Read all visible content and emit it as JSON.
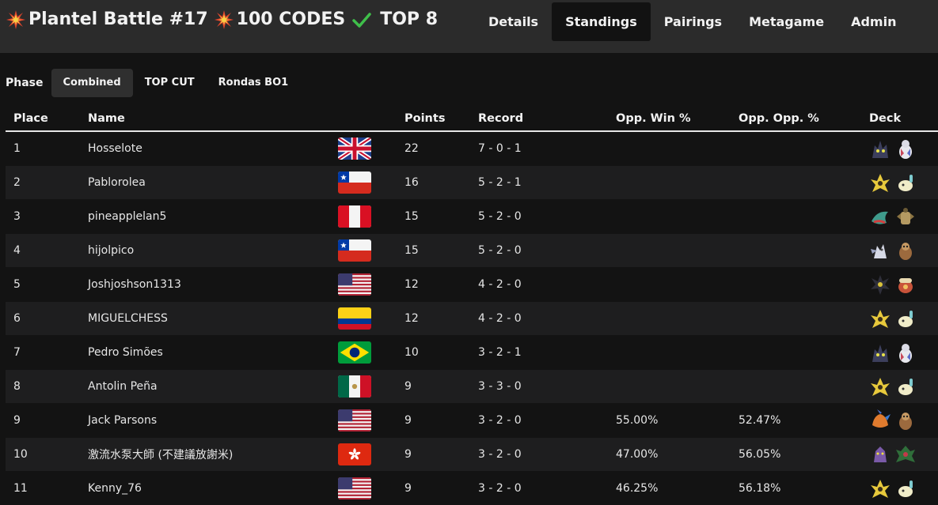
{
  "header": {
    "title_parts": [
      "Plantel Battle #17",
      "100 CODES",
      "TOP 8"
    ],
    "nav": [
      {
        "label": "Details",
        "active": false
      },
      {
        "label": "Standings",
        "active": true
      },
      {
        "label": "Pairings",
        "active": false
      },
      {
        "label": "Metagame",
        "active": false
      },
      {
        "label": "Admin",
        "active": false
      }
    ]
  },
  "phase": {
    "label": "Phase",
    "options": [
      {
        "label": "Combined",
        "active": true
      },
      {
        "label": "TOP CUT",
        "active": false
      },
      {
        "label": "Rondas BO1",
        "active": false
      }
    ]
  },
  "table": {
    "headers": {
      "place": "Place",
      "name": "Name",
      "points": "Points",
      "record": "Record",
      "opp_win": "Opp. Win %",
      "opp_opp": "Opp. Opp. %",
      "deck": "Deck"
    },
    "rows": [
      {
        "place": "1",
        "name": "Hosselote",
        "flag": "uk-flag",
        "points": "22",
        "record": "7 - 0 - 1",
        "opp_win": "",
        "opp_opp": "",
        "deck": [
          "dark-pokemon-icon",
          "white-pokemon-icon"
        ]
      },
      {
        "place": "2",
        "name": "Pablorolea",
        "flag": "chile-flag",
        "points": "16",
        "record": "5 - 2 - 1",
        "opp_win": "",
        "opp_opp": "",
        "deck": [
          "yellow-pokemon-icon",
          "cream-pokemon-icon"
        ]
      },
      {
        "place": "3",
        "name": "pineapplelan5",
        "flag": "peru-flag",
        "points": "15",
        "record": "5 - 2 - 0",
        "opp_win": "",
        "opp_opp": "",
        "deck": [
          "dragon-pokemon-icon",
          "tan-pokemon-icon"
        ]
      },
      {
        "place": "4",
        "name": "hijolpico",
        "flag": "chile-flag",
        "points": "15",
        "record": "5 - 2 - 0",
        "opp_win": "",
        "opp_opp": "",
        "deck": [
          "silver-pokemon-icon",
          "brown-pokemon-icon"
        ]
      },
      {
        "place": "5",
        "name": "Joshjoshson1313",
        "flag": "usa-flag",
        "points": "12",
        "record": "4 - 2 - 0",
        "opp_win": "",
        "opp_opp": "",
        "deck": [
          "dark-spiky-pokemon-icon",
          "red-pokemon-icon"
        ]
      },
      {
        "place": "6",
        "name": "MIGUELCHESS",
        "flag": "colombia-flag",
        "points": "12",
        "record": "4 - 2 - 0",
        "opp_win": "",
        "opp_opp": "",
        "deck": [
          "yellow-pokemon-icon",
          "cream-pokemon-icon"
        ]
      },
      {
        "place": "7",
        "name": "Pedro Simões",
        "flag": "brazil-flag",
        "points": "10",
        "record": "3 - 2 - 1",
        "opp_win": "",
        "opp_opp": "",
        "deck": [
          "dark-pokemon-icon",
          "white-pokemon-icon"
        ]
      },
      {
        "place": "8",
        "name": "Antolin Peña",
        "flag": "mexico-flag",
        "points": "9",
        "record": "3 - 3 - 0",
        "opp_win": "",
        "opp_opp": "",
        "deck": [
          "yellow-pokemon-icon",
          "cream-pokemon-icon"
        ]
      },
      {
        "place": "9",
        "name": "Jack Parsons",
        "flag": "usa-flag",
        "points": "9",
        "record": "3 - 2 - 0",
        "opp_win": "55.00%",
        "opp_opp": "52.47%",
        "deck": [
          "orange-pokemon-icon",
          "brown-pokemon-icon"
        ]
      },
      {
        "place": "10",
        "name": "激流水泵大師 (不建議放謝米)",
        "flag": "hong-kong-flag",
        "points": "9",
        "record": "3 - 2 - 0",
        "opp_win": "47.00%",
        "opp_opp": "56.05%",
        "deck": [
          "purple-pokemon-icon",
          "green-pokemon-icon"
        ]
      },
      {
        "place": "11",
        "name": "Kenny_76",
        "flag": "usa-flag",
        "points": "9",
        "record": "3 - 2 - 0",
        "opp_win": "46.25%",
        "opp_opp": "56.18%",
        "deck": [
          "yellow-pokemon-icon",
          "cream-pokemon-icon"
        ]
      }
    ]
  }
}
